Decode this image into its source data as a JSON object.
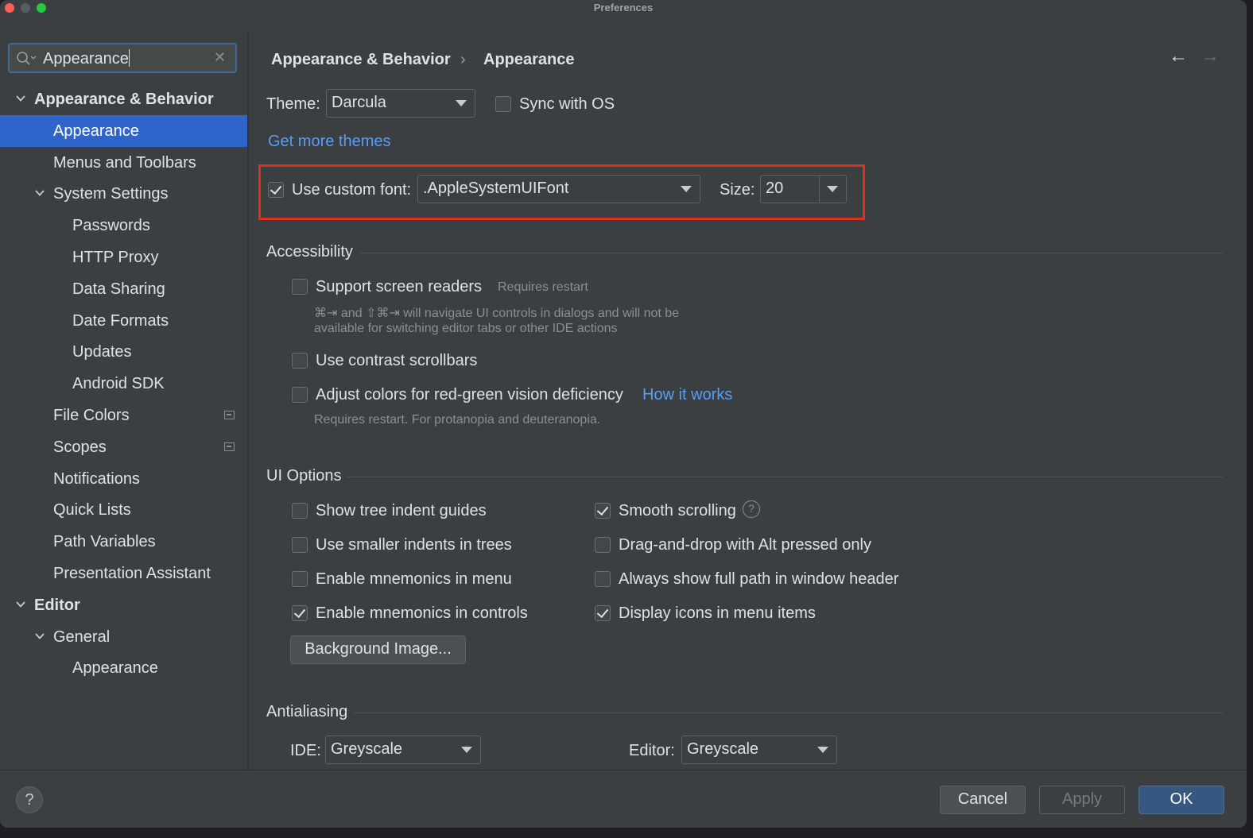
{
  "window": {
    "title": "Preferences"
  },
  "search": {
    "value": "Appearance",
    "clear_glyph": "✕"
  },
  "tree": [
    {
      "label": "Appearance & Behavior",
      "name": "tree-item-appearance-behavior",
      "expanded": true,
      "bold": true
    },
    {
      "label": "Appearance",
      "name": "tree-item-appearance",
      "selected": true
    },
    {
      "label": "Menus and Toolbars",
      "name": "tree-item-menus-and-toolbars"
    },
    {
      "label": "System Settings",
      "name": "tree-item-system-settings",
      "expanded": true
    },
    {
      "label": "Passwords",
      "name": "tree-item-passwords"
    },
    {
      "label": "HTTP Proxy",
      "name": "tree-item-http-proxy"
    },
    {
      "label": "Data Sharing",
      "name": "tree-item-data-sharing"
    },
    {
      "label": "Date Formats",
      "name": "tree-item-date-formats"
    },
    {
      "label": "Updates",
      "name": "tree-item-updates"
    },
    {
      "label": "Android SDK",
      "name": "tree-item-android-sdk"
    },
    {
      "label": "File Colors",
      "name": "tree-item-file-colors",
      "badge": "project-scope-icon"
    },
    {
      "label": "Scopes",
      "name": "tree-item-scopes",
      "badge": "project-scope-icon"
    },
    {
      "label": "Notifications",
      "name": "tree-item-notifications"
    },
    {
      "label": "Quick Lists",
      "name": "tree-item-quick-lists"
    },
    {
      "label": "Path Variables",
      "name": "tree-item-path-variables"
    },
    {
      "label": "Presentation Assistant",
      "name": "tree-item-presentation-assistant"
    },
    {
      "label": "Editor",
      "name": "tree-item-editor",
      "expanded": true,
      "bold": true
    },
    {
      "label": "General",
      "name": "tree-item-general",
      "expanded": true
    },
    {
      "label": "Appearance",
      "name": "tree-item-editor-appearance"
    }
  ],
  "breadcrumb": {
    "parent": "Appearance & Behavior",
    "separator": "›",
    "current": "Appearance"
  },
  "nav": {
    "back": "←",
    "forward": "→"
  },
  "theme": {
    "label": "Theme:",
    "value": "Darcula",
    "sync_label": "Sync with OS",
    "sync_checked": false,
    "more_link": "Get more themes"
  },
  "font": {
    "checked": true,
    "label": "Use custom font:",
    "value": ".AppleSystemUIFont",
    "size_label": "Size:",
    "size_value": "20"
  },
  "accessibility": {
    "title": "Accessibility",
    "screen_readers": {
      "label": "Support screen readers",
      "note": "Requires restart",
      "checked": false
    },
    "screen_readers_hint_1": "⌘⇥ and ⇧⌘⇥ will navigate UI controls in dialogs and will not be",
    "screen_readers_hint_2": "available for switching editor tabs or other IDE actions",
    "contrast_scrollbars": {
      "label": "Use contrast scrollbars",
      "checked": false
    },
    "color_deficiency": {
      "label": "Adjust colors for red-green vision deficiency",
      "checked": false,
      "link": "How it works"
    },
    "color_deficiency_hint": "Requires restart. For protanopia and deuteranopia."
  },
  "ui_options": {
    "title": "UI Options",
    "left": [
      {
        "label": "Show tree indent guides",
        "checked": false
      },
      {
        "label": "Use smaller indents in trees",
        "checked": false
      },
      {
        "label": "Enable mnemonics in menu",
        "checked": false
      },
      {
        "label": "Enable mnemonics in controls",
        "checked": true
      }
    ],
    "right": [
      {
        "label": "Smooth scrolling",
        "checked": true
      },
      {
        "label": "Drag-and-drop with Alt pressed only",
        "checked": false
      },
      {
        "label": "Always show full path in window header",
        "checked": false
      },
      {
        "label": "Display icons in menu items",
        "checked": true
      }
    ],
    "help_glyph": "?",
    "background_button": "Background Image..."
  },
  "antialiasing": {
    "title": "Antialiasing",
    "ide_label": "IDE:",
    "ide_value": "Greyscale",
    "editor_label": "Editor:",
    "editor_value": "Greyscale"
  },
  "footer": {
    "help": "?",
    "cancel": "Cancel",
    "apply": "Apply",
    "ok": "OK"
  }
}
